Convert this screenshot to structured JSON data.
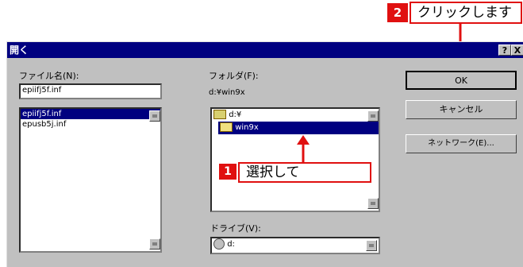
{
  "dialog": {
    "title": "開く",
    "help_label": "?",
    "close_label": "X"
  },
  "filename": {
    "label": "ファイル名(N):",
    "value": "epiifj5f.inf",
    "list": [
      "epiifj5f.inf",
      "epusb5j.inf"
    ]
  },
  "folder": {
    "label": "フォルダ(F):",
    "path": "d:¥win9x",
    "items": [
      "d:¥",
      "win9x"
    ]
  },
  "drive": {
    "label": "ドライブ(V):",
    "value": "d:"
  },
  "buttons": {
    "ok": "OK",
    "cancel": "キャンセル",
    "network": "ネットワーク(E)..."
  },
  "annotations": {
    "step1_number": "1",
    "step1_text": "選択して",
    "step2_number": "2",
    "step2_text": "クリックします",
    "accent_color": "#e01010"
  }
}
